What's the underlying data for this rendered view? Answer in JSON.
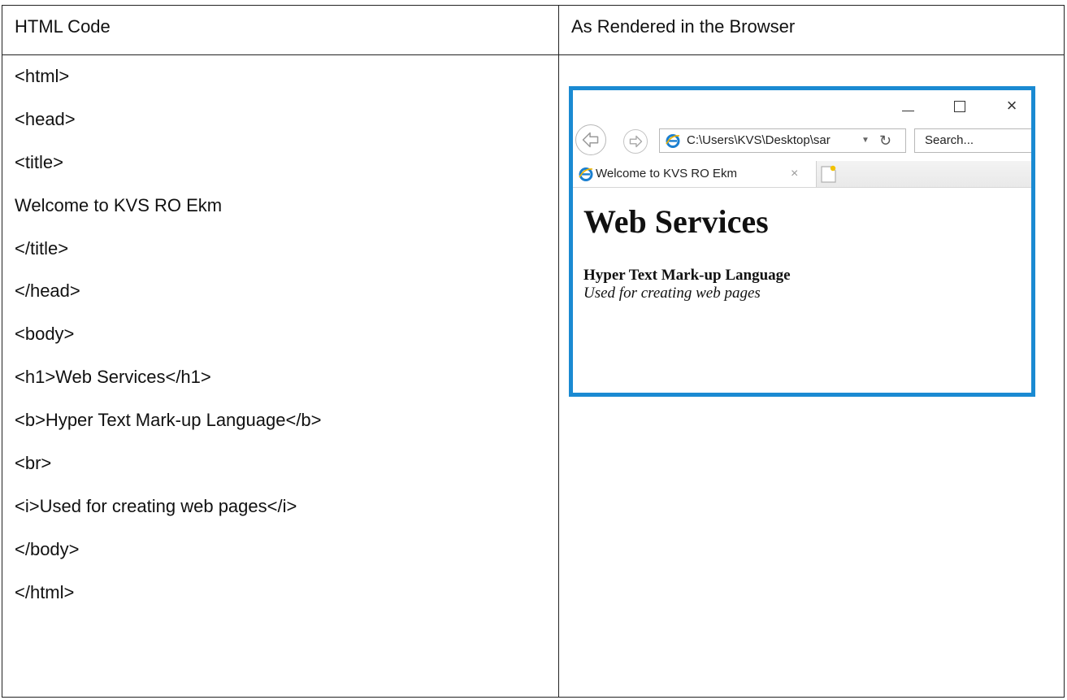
{
  "table": {
    "headers": {
      "code": "HTML Code",
      "rendered": "As Rendered in the Browser"
    },
    "code_lines": [
      "<html>",
      "<head>",
      "<title>",
      "Welcome to KVS RO Ekm",
      "</title>",
      "</head>",
      "<body>",
      "<h1>Web Services</h1>",
      "<b>Hyper Text Mark-up Language</b>",
      "<br>",
      "<i>Used for creating web pages</i>",
      "</body>",
      "</html>"
    ]
  },
  "browser": {
    "frame_color": "#1a8ad2",
    "title_buttons": [
      "minimize-icon",
      "maximize-icon",
      "close-icon"
    ],
    "close_glyph": "×",
    "address_url": "C:\\Users\\KVS\\Desktop\\sar",
    "address_dropdown": "▼",
    "address_refresh": "↻",
    "search_placeholder": "Search...",
    "tab_title": "Welcome to KVS RO Ekm",
    "tab_close": "×",
    "page": {
      "h1": "Web Services",
      "bold": "Hyper Text Mark-up Language",
      "italic": "Used for creating web pages"
    }
  }
}
